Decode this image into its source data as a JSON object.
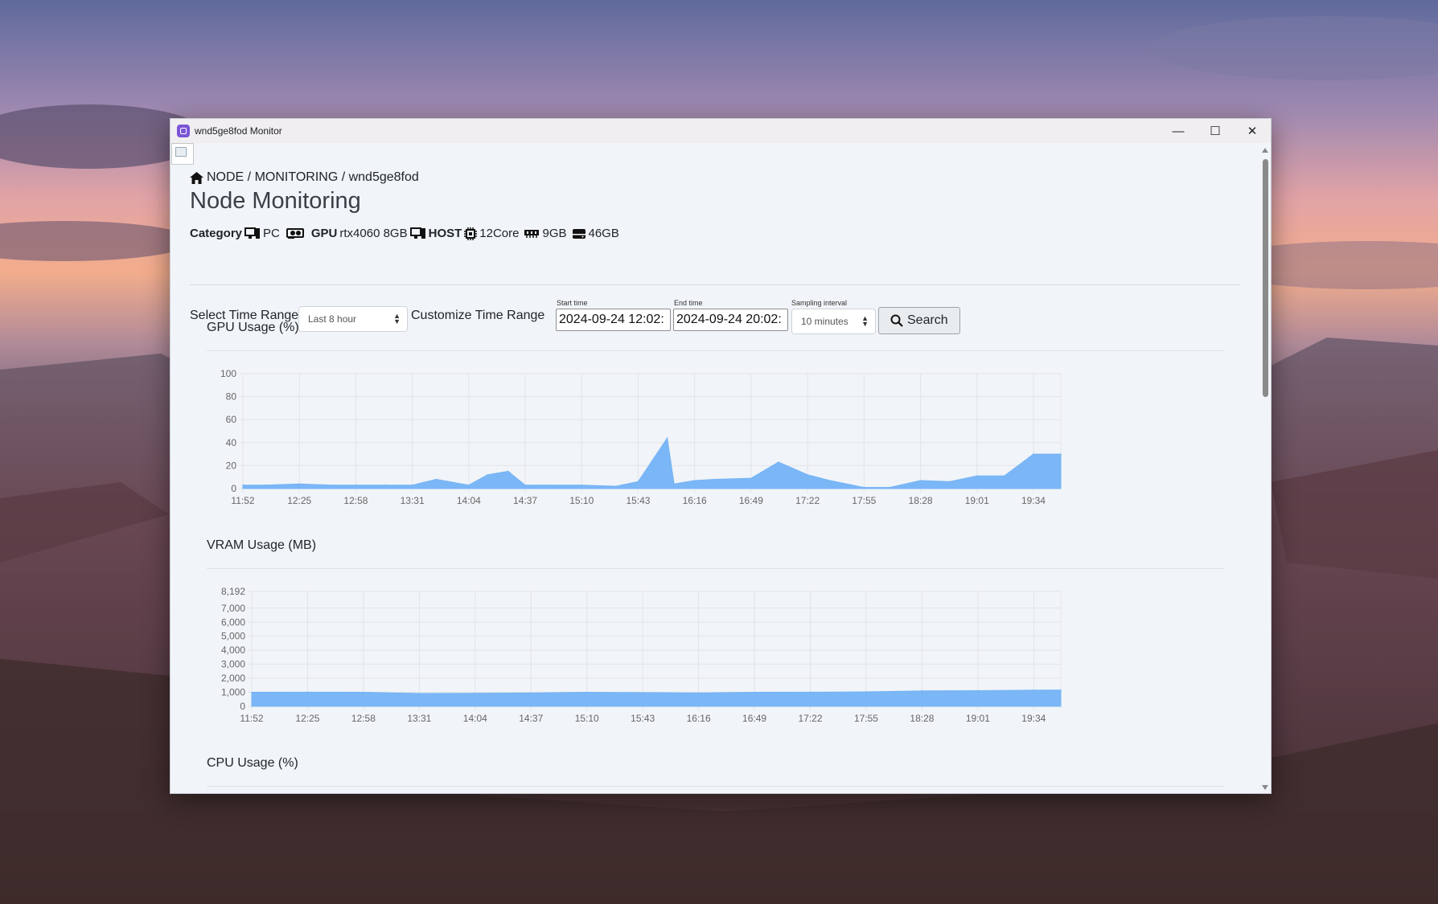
{
  "window": {
    "title": "wnd5ge8fod Monitor",
    "controls": {
      "minimize": "—",
      "maximize": "☐",
      "close": "✕"
    }
  },
  "breadcrumb": "NODE / MONITORING / wnd5ge8fod",
  "page_title": "Node Monitoring",
  "specs": {
    "category_label": "Category",
    "category_value": "PC",
    "gpu_label": "GPU",
    "gpu_value": "rtx4060 8GB",
    "host_label": "HOST",
    "cpu_value": "12Core",
    "ram_value": "9GB",
    "disk_value": "46GB"
  },
  "controls": {
    "select_time_range_label": "Select Time Range",
    "time_range_value": "Last 8 hour",
    "customize_label": "Customize Time Range",
    "start_time_label": "Start time",
    "start_time_value": "2024-09-24 12:02:",
    "end_time_label": "End time",
    "end_time_value": "2024-09-24 20:02:",
    "sampling_label": "Sampling interval",
    "sampling_value": "10 minutes",
    "search_label": "Search"
  },
  "sections": {
    "gpu_title": "GPU Usage (%)",
    "vram_title": "VRAM Usage (MB)",
    "cpu_title": "CPU Usage (%)"
  },
  "chart_data": [
    {
      "type": "area",
      "title": "GPU Usage (%)",
      "ylim": [
        0,
        100
      ],
      "yticks": [
        0,
        20,
        40,
        60,
        80,
        100
      ],
      "xticks": [
        "11:52",
        "12:25",
        "12:58",
        "13:31",
        "14:04",
        "14:37",
        "15:10",
        "15:43",
        "16:16",
        "16:49",
        "17:22",
        "17:55",
        "18:28",
        "19:01",
        "19:34"
      ],
      "x": [
        "11:52",
        "12:05",
        "12:25",
        "12:45",
        "12:58",
        "13:15",
        "13:31",
        "13:45",
        "14:04",
        "14:15",
        "14:27",
        "14:37",
        "14:48",
        "15:10",
        "15:30",
        "15:43",
        "16:00",
        "16:04",
        "16:16",
        "16:28",
        "16:49",
        "17:05",
        "17:22",
        "17:35",
        "17:55",
        "18:10",
        "18:28",
        "18:45",
        "19:01",
        "19:17",
        "19:34",
        "19:50"
      ],
      "series": [
        {
          "values": [
            3,
            3,
            4,
            3,
            3,
            3,
            3,
            8,
            3,
            12,
            15,
            3,
            3,
            3,
            2,
            6,
            44,
            4,
            7,
            8,
            9,
            23,
            12,
            7,
            1,
            1,
            7,
            6,
            11,
            11,
            30,
            30
          ]
        }
      ],
      "grid": true,
      "color": "#74b3f5"
    },
    {
      "type": "area",
      "title": "VRAM Usage (MB)",
      "ylim": [
        0,
        8192
      ],
      "yticks": [
        0,
        1000,
        2000,
        3000,
        4000,
        5000,
        6000,
        7000,
        8192
      ],
      "ytick_labels": [
        "0",
        "1,000",
        "2,000",
        "3,000",
        "4,000",
        "5,000",
        "6,000",
        "7,000",
        "8,192"
      ],
      "xticks": [
        "11:52",
        "12:25",
        "12:58",
        "13:31",
        "14:04",
        "14:37",
        "15:10",
        "15:43",
        "16:16",
        "16:49",
        "17:22",
        "17:55",
        "18:28",
        "19:01",
        "19:34"
      ],
      "x": [
        "11:52",
        "12:25",
        "12:58",
        "13:31",
        "14:04",
        "14:37",
        "15:10",
        "15:43",
        "16:16",
        "16:49",
        "17:22",
        "17:55",
        "18:28",
        "19:01",
        "19:34",
        "19:50"
      ],
      "series": [
        {
          "values": [
            1000,
            1010,
            1000,
            920,
            930,
            950,
            1000,
            980,
            950,
            1000,
            1010,
            1030,
            1100,
            1120,
            1150,
            1160
          ]
        }
      ],
      "grid": true,
      "color": "#74b3f5"
    }
  ]
}
